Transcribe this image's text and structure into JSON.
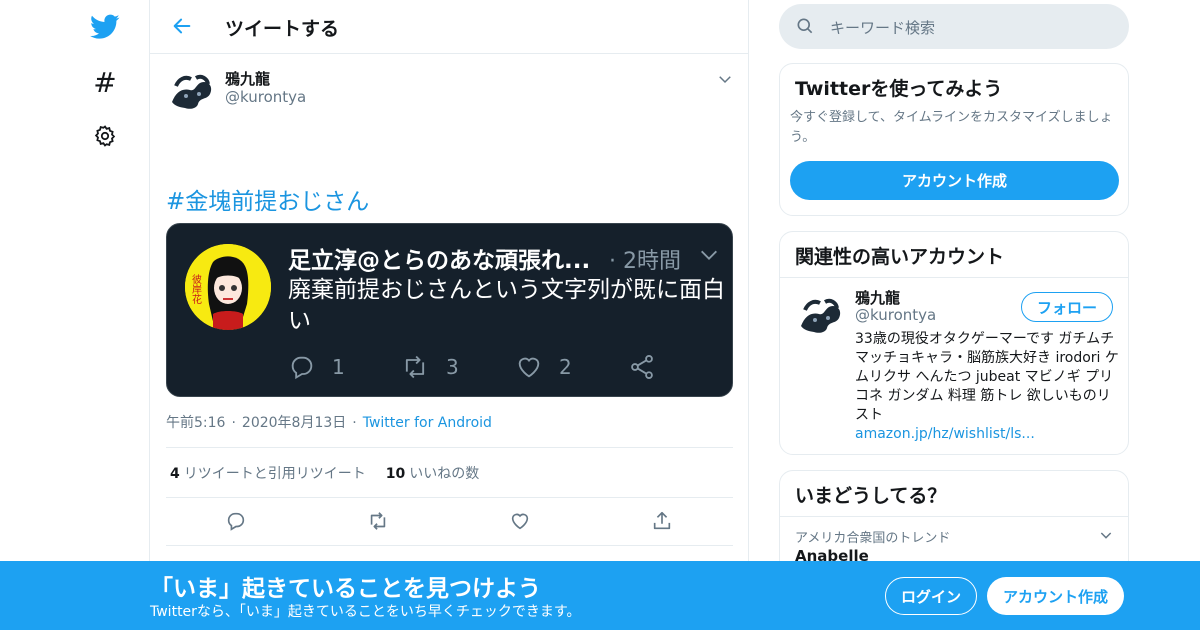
{
  "nav": {
    "icons": [
      "twitter-bird-icon",
      "hashtag-icon",
      "gear-icon"
    ],
    "hashtag_glyph": "#"
  },
  "header": {
    "title": "ツイートする"
  },
  "tweet": {
    "author_name": "鴉九龍",
    "author_handle": "@kurontya",
    "text": "#金塊前提おじさん",
    "quoted": {
      "author_name": "足立淳@とらのあな頑張れ...",
      "time": "· 2時間",
      "text": "廃棄前提おじさんという文字列が既に面白い",
      "reply_count": "1",
      "retweet_count": "3",
      "like_count": "2",
      "avatar_label": "彼岸花"
    },
    "time": "午前5:16",
    "date": "2020年8月13日",
    "separator": "·",
    "client": "Twitter for Android",
    "retweet_count": "4",
    "retweet_label": "リツイートと引用リツイート",
    "like_count": "10",
    "like_label": "いいねの数"
  },
  "sidebar": {
    "search_placeholder": "キーワード検索",
    "try_card": {
      "title": "Twitterを使ってみよう",
      "desc": "今すぐ登録して、タイムラインをカスタマイズしましょう。",
      "button": "アカウント作成"
    },
    "related": {
      "title": "関連性の高いアカウント",
      "name": "鴉九龍",
      "handle": "@kurontya",
      "follow": "フォロー",
      "bio": "33歳の現役オタクゲーマーです ガチムチマッチョキャラ・脳筋族大好き irodori ケムリクサ へんたつ jubeat マビノギ プリコネ ガンダム 料理 筋トレ 欲しいものリスト",
      "link": "amazon.jp/hz/wishlist/ls..."
    },
    "trends": {
      "title": "いまどうしてる？",
      "context": "アメリカ合衆国のトレンド",
      "name": "Anabelle"
    }
  },
  "bottom_bar": {
    "title": "「いま」起きていることを見つけよう",
    "subtitle": "Twitterなら、「いま」起きていることをいち早くチェックできます。",
    "login": "ログイン",
    "signup": "アカウント作成"
  },
  "colors": {
    "brand": "#1da1f2",
    "quote_bg": "#15202b",
    "muted": "#657786"
  }
}
